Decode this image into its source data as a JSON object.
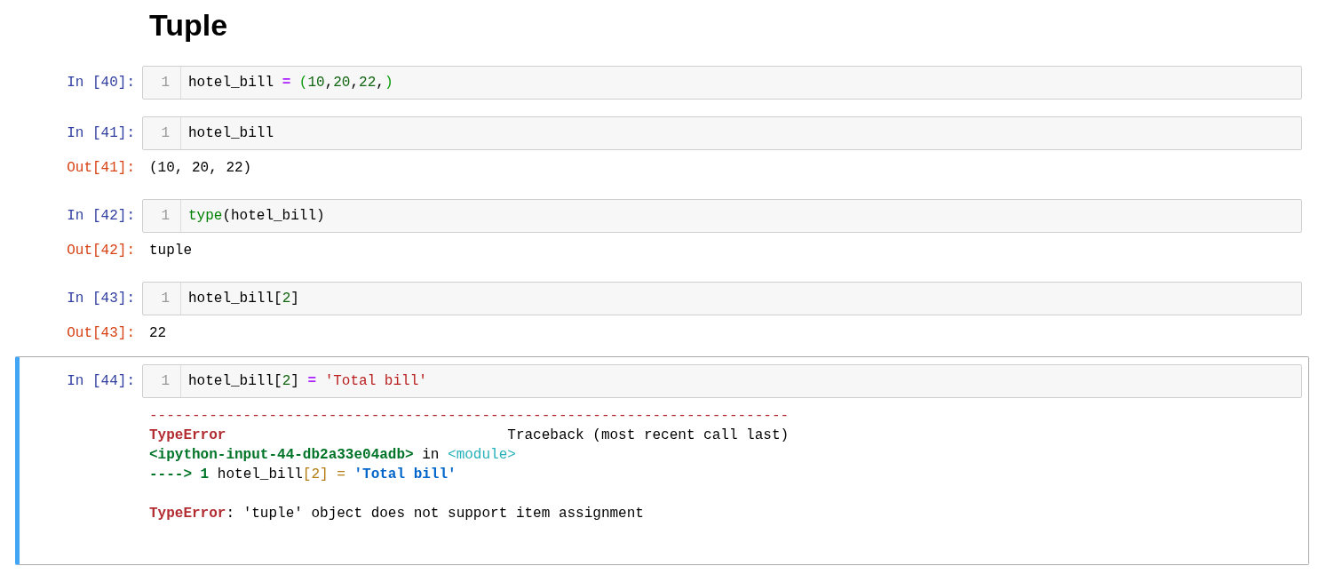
{
  "heading": "Tuple",
  "cells": [
    {
      "prompt": "In [40]:",
      "selected": false,
      "line_number": "1",
      "code": [
        {
          "text": "hotel_bill ",
          "kind": "plain"
        },
        {
          "text": "=",
          "kind": "op"
        },
        {
          "text": " (",
          "kind": "paren"
        },
        {
          "text": "10",
          "kind": "num"
        },
        {
          "text": ",",
          "kind": "plain"
        },
        {
          "text": "20",
          "kind": "num"
        },
        {
          "text": ",",
          "kind": "plain"
        },
        {
          "text": "22",
          "kind": "num"
        },
        {
          "text": ",",
          "kind": "plain"
        },
        {
          "text": ")",
          "kind": "paren"
        }
      ]
    },
    {
      "prompt": "In [41]:",
      "selected": false,
      "line_number": "1",
      "code": [
        {
          "text": "hotel_bill",
          "kind": "plain"
        }
      ],
      "output": {
        "prompt": "Out[41]:",
        "text": "(10, 20, 22)"
      }
    },
    {
      "prompt": "In [42]:",
      "selected": false,
      "line_number": "1",
      "code": [
        {
          "text": "type",
          "kind": "builtin"
        },
        {
          "text": "(hotel_bill)",
          "kind": "plain"
        }
      ],
      "output": {
        "prompt": "Out[42]:",
        "text": "tuple"
      }
    },
    {
      "prompt": "In [43]:",
      "selected": false,
      "line_number": "1",
      "code": [
        {
          "text": "hotel_bill[",
          "kind": "plain"
        },
        {
          "text": "2",
          "kind": "num"
        },
        {
          "text": "]",
          "kind": "plain"
        }
      ],
      "output": {
        "prompt": "Out[43]:",
        "text": "22"
      }
    },
    {
      "prompt": "In [44]:",
      "selected": true,
      "line_number": "1",
      "code": [
        {
          "text": "hotel_bill[",
          "kind": "plain"
        },
        {
          "text": "2",
          "kind": "num"
        },
        {
          "text": "] ",
          "kind": "plain"
        },
        {
          "text": "=",
          "kind": "op"
        },
        {
          "text": " 'Total bill'",
          "kind": "str"
        }
      ],
      "traceback_blocks": [
        [
          [
            {
              "text": "---------------------------------------------------------------------------",
              "kind": "tb-red"
            }
          ],
          [
            {
              "text": "TypeError",
              "kind": "tb-red-bold"
            },
            {
              "text": "                                 Traceback (most recent call last)",
              "kind": "plain"
            }
          ],
          [
            {
              "text": "<ipython-input-44-db2a33e04adb>",
              "kind": "tb-green-bold"
            },
            {
              "text": " in ",
              "kind": "plain"
            },
            {
              "text": "<module>",
              "kind": "tb-cyan"
            }
          ],
          [
            {
              "text": "----> 1",
              "kind": "tb-green-bold"
            },
            {
              "text": " hotel_bill",
              "kind": "plain"
            },
            {
              "text": "[2] = ",
              "kind": "tb-orange"
            },
            {
              "text": "'Total bill'",
              "kind": "tb-blue-bold"
            }
          ]
        ],
        [
          [
            {
              "text": "TypeError",
              "kind": "tb-red-bold"
            },
            {
              "text": ": 'tuple' object does not support item assignment",
              "kind": "plain"
            }
          ]
        ]
      ]
    }
  ]
}
